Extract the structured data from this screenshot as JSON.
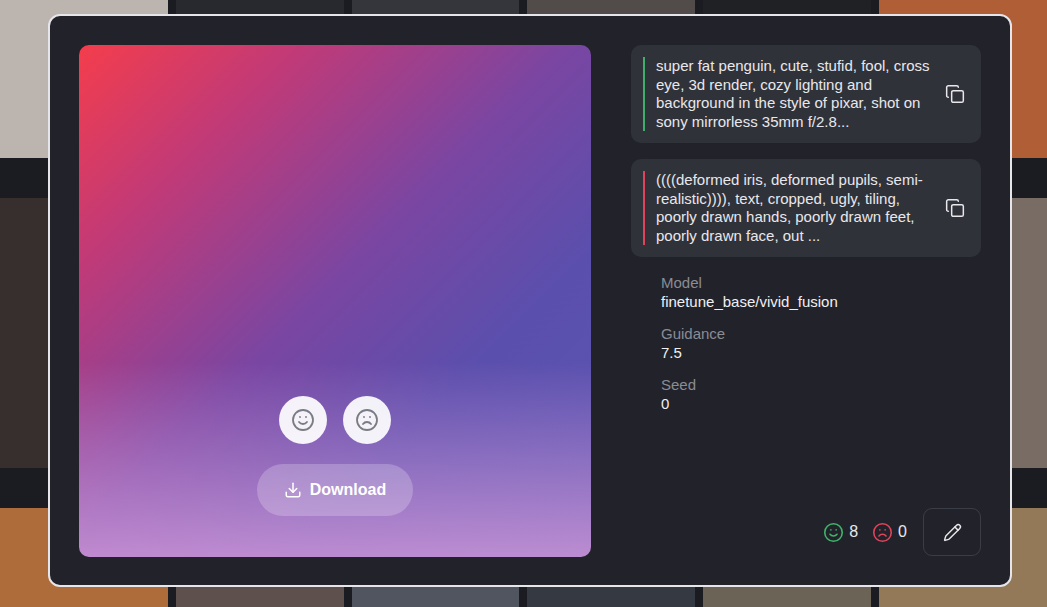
{
  "image": {
    "download_label": "Download"
  },
  "prompts": [
    {
      "kind": "positive",
      "text": "super fat penguin, cute, stufid, fool, cross eye, 3d render, cozy lighting and background in the style of pixar, shot on sony mirrorless 35mm f/2.8...",
      "color": "#3fae6a"
    },
    {
      "kind": "negative",
      "text": "((((deformed iris, deformed pupils, semi-realistic)))), text, cropped, ugly, tiling, poorly drawn hands, poorly drawn feet, poorly drawn face, out ...",
      "color": "#e0445a"
    }
  ],
  "details": [
    {
      "label": "Model",
      "value": "finetune_base/vivid_fusion"
    },
    {
      "label": "Guidance",
      "value": "7.5"
    },
    {
      "label": "Seed",
      "value": "0"
    }
  ],
  "votes": [
    {
      "kind": "up",
      "count": "8",
      "color": "#3fb56a"
    },
    {
      "kind": "down",
      "count": "0",
      "color": "#e0445a"
    }
  ]
}
